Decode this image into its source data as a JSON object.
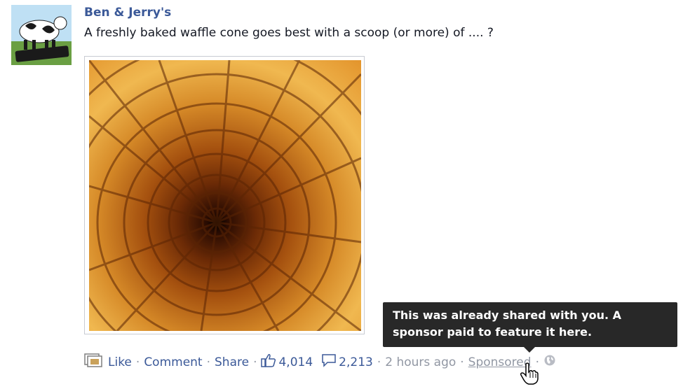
{
  "post": {
    "author": "Ben & Jerry's",
    "avatar_text": "BEN & JERRY'S",
    "message": "A freshly baked waffle cone goes best with a scoop (or more) of .... ?",
    "photo_alt": "waffle cone interior"
  },
  "actions": {
    "like": "Like",
    "comment": "Comment",
    "share": "Share",
    "like_count": "4,014",
    "comment_count": "2,213",
    "timestamp": "2 hours ago",
    "sponsored": "Sponsored",
    "separator": "·"
  },
  "tooltip": {
    "text": "This was already shared with you. A sponsor paid to feature it here."
  },
  "icons": {
    "like": "thumbs-up-icon",
    "comment": "speech-bubble-icon",
    "privacy": "globe-icon",
    "share_type": "shared-post-icon"
  }
}
